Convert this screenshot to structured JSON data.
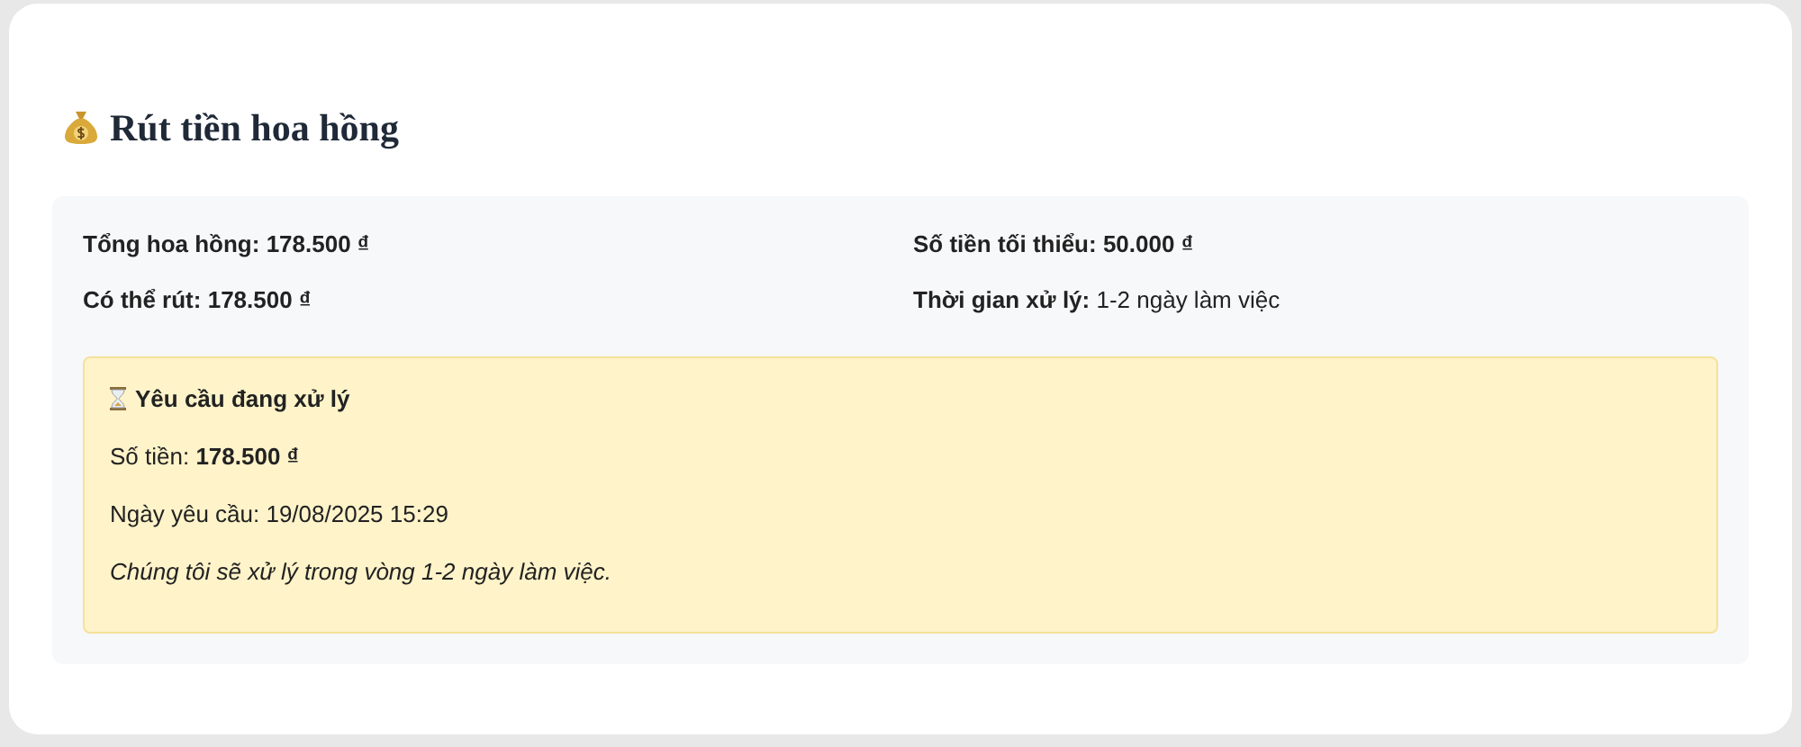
{
  "title": "Rút tiền hoa hồng",
  "summary": [
    {
      "label": "Tổng hoa hồng:",
      "value": "178.500 ₫",
      "value_bold": true
    },
    {
      "label": "Số tiền tối thiểu:",
      "value": "50.000 ₫",
      "value_bold": true
    },
    {
      "label": "Có thể rút:",
      "value": "178.500 ₫",
      "value_bold": true
    },
    {
      "label": "Thời gian xử lý:",
      "value": "1-2 ngày làm việc",
      "value_bold": false
    }
  ],
  "pending": {
    "title": "Yêu cầu đang xử lý",
    "amount": "Số tiền: **178.500 ₫**",
    "date": "Ngày yêu cầu: 19/08/2025 15:29",
    "note": "Chúng tôi sẽ xử lý trong vòng 1-2 ngày làm việc."
  }
}
